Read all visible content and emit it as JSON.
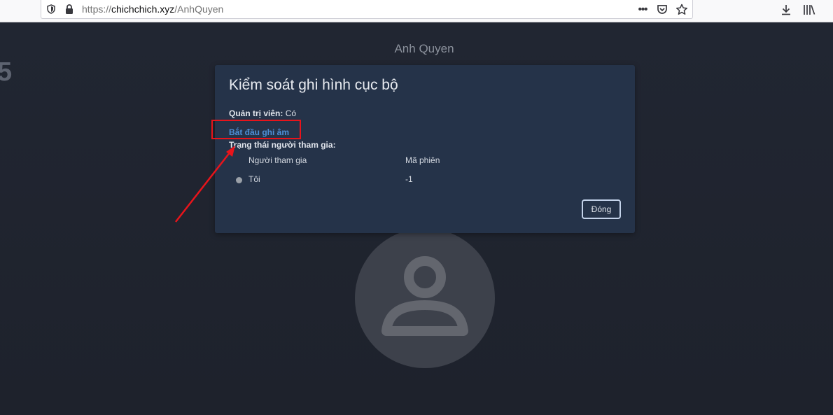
{
  "browser": {
    "url_scheme": "https://",
    "url_host": "chichchich.xyz",
    "url_path": "/AnhQuyen",
    "more_label": "•••"
  },
  "page": {
    "bg_number": "5",
    "room_name": "Anh Quyen"
  },
  "dialog": {
    "title": "Kiểm soát ghi hình cục bộ",
    "moderator_label": "Quản trị viên:",
    "moderator_value": "Có",
    "start_recording_link": "Bắt đầu ghi âm",
    "participant_status_label": "Trạng thái người tham gia:",
    "table": {
      "headers": [
        "Người tham gia",
        "Mã phiên"
      ],
      "rows": [
        {
          "participant": "Tôi",
          "session_id": "-1",
          "status_color": "#9aa0a8"
        }
      ]
    },
    "close_button": "Đóng"
  },
  "annotation": {
    "highlight_color": "#e8141b"
  }
}
